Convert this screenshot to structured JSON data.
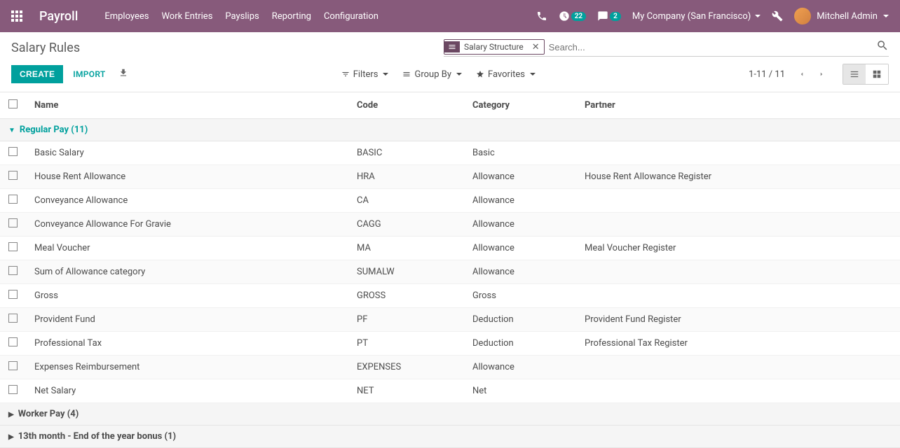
{
  "navbar": {
    "app_title": "Payroll",
    "menu": [
      "Employees",
      "Work Entries",
      "Payslips",
      "Reporting",
      "Configuration"
    ],
    "clock_badge": "22",
    "msg_badge": "2",
    "company": "My Company (San Francisco)",
    "user": "Mitchell Admin"
  },
  "breadcrumb": "Salary Rules",
  "search": {
    "facet_label": "Salary Structure",
    "placeholder": "Search..."
  },
  "buttons": {
    "create": "CREATE",
    "import": "IMPORT"
  },
  "dropdowns": {
    "filters": "Filters",
    "group_by": "Group By",
    "favorites": "Favorites"
  },
  "pager": "1-11 / 11",
  "columns": {
    "name": "Name",
    "code": "Code",
    "category": "Category",
    "partner": "Partner"
  },
  "groups": [
    {
      "label": "Regular Pay (11)",
      "expanded": true,
      "rows": [
        {
          "name": "Basic Salary",
          "code": "BASIC",
          "category": "Basic",
          "partner": ""
        },
        {
          "name": "House Rent Allowance",
          "code": "HRA",
          "category": "Allowance",
          "partner": "House Rent Allowance Register"
        },
        {
          "name": "Conveyance Allowance",
          "code": "CA",
          "category": "Allowance",
          "partner": ""
        },
        {
          "name": "Conveyance Allowance For Gravie",
          "code": "CAGG",
          "category": "Allowance",
          "partner": ""
        },
        {
          "name": "Meal Voucher",
          "code": "MA",
          "category": "Allowance",
          "partner": "Meal Voucher Register"
        },
        {
          "name": "Sum of Allowance category",
          "code": "SUMALW",
          "category": "Allowance",
          "partner": ""
        },
        {
          "name": "Gross",
          "code": "GROSS",
          "category": "Gross",
          "partner": ""
        },
        {
          "name": "Provident Fund",
          "code": "PF",
          "category": "Deduction",
          "partner": "Provident Fund Register"
        },
        {
          "name": "Professional Tax",
          "code": "PT",
          "category": "Deduction",
          "partner": "Professional Tax Register"
        },
        {
          "name": "Expenses Reimbursement",
          "code": "EXPENSES",
          "category": "Allowance",
          "partner": ""
        },
        {
          "name": "Net Salary",
          "code": "NET",
          "category": "Net",
          "partner": ""
        }
      ]
    },
    {
      "label": "Worker Pay (4)",
      "expanded": false,
      "rows": []
    },
    {
      "label": "13th month - End of the year bonus (1)",
      "expanded": false,
      "rows": []
    }
  ]
}
